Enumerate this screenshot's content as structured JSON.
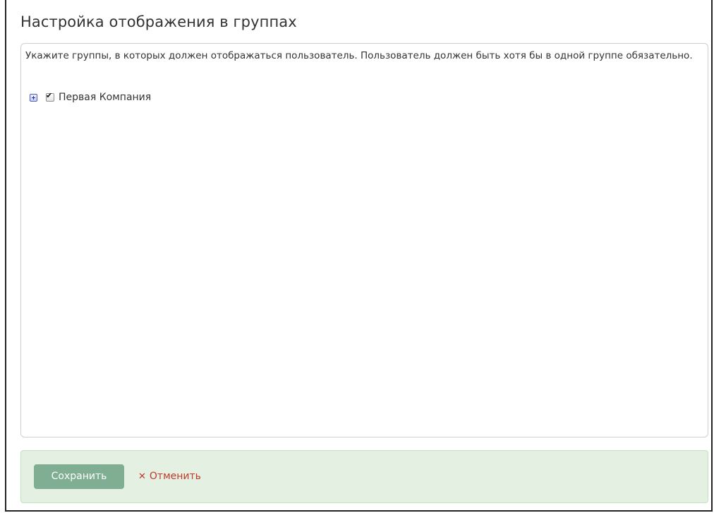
{
  "dialog": {
    "title": "Настройка отображения в группах",
    "instructions": "Укажите группы, в которых должен отображаться пользователь. Пользователь должен быть хотя бы в одной группе обязательно."
  },
  "tree": {
    "items": [
      {
        "label": "Первая Компания",
        "checked": true,
        "expanded": false
      }
    ]
  },
  "footer": {
    "save_label": "Сохранить",
    "cancel_label": "Отменить"
  },
  "colors": {
    "save_button": "#7fae93",
    "footer_background": "#e4f0e1",
    "cancel_text": "#c0392b"
  },
  "icons": {
    "expand": "plus-box-icon",
    "checkbox": "checkmark",
    "cancel": "close-x-icon"
  }
}
